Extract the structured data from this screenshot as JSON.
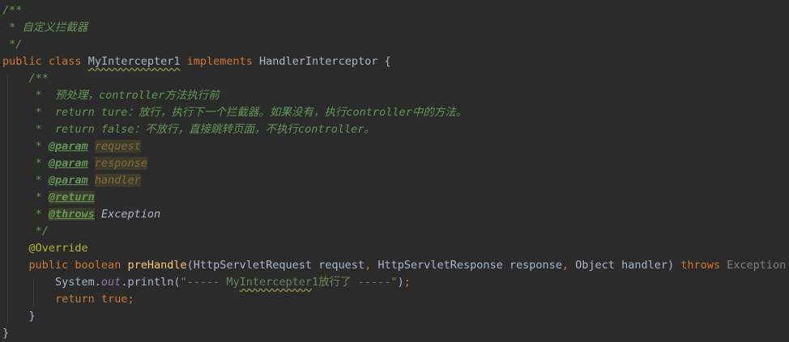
{
  "editor": {
    "lines": [
      {
        "segments": [
          {
            "t": "/**",
            "c": "cmt"
          }
        ]
      },
      {
        "segments": [
          {
            "t": " * 自定义拦截器",
            "c": "cmt"
          }
        ]
      },
      {
        "segments": [
          {
            "t": " */",
            "c": "cmt"
          }
        ]
      },
      {
        "segments": [
          {
            "t": "public ",
            "c": "kw"
          },
          {
            "t": "class ",
            "c": "kw"
          },
          {
            "t": "MyIntercepter1",
            "c": "squig"
          },
          {
            "t": " "
          },
          {
            "t": "implements ",
            "c": "kw"
          },
          {
            "t": "HandlerInterceptor {"
          }
        ]
      },
      {
        "segments": [
          {
            "t": "    /**",
            "c": "cmt"
          }
        ]
      },
      {
        "segments": [
          {
            "t": "     *  预处理，controller方法执行前",
            "c": "cmt"
          }
        ]
      },
      {
        "segments": [
          {
            "t": "     *  return ture：放行，执行下一个拦截器。如果没有，执行controller中的方法。",
            "c": "cmt"
          }
        ]
      },
      {
        "segments": [
          {
            "t": "     *  return false：不放行，直接跳转页面，不执行controller。",
            "c": "cmt"
          }
        ]
      },
      {
        "segments": [
          {
            "t": "     * ",
            "c": "cmt"
          },
          {
            "t": "@param",
            "c": "tag"
          },
          {
            "t": " ",
            "c": "cmt"
          },
          {
            "t": "request",
            "c": "pname"
          }
        ]
      },
      {
        "segments": [
          {
            "t": "     * ",
            "c": "cmt"
          },
          {
            "t": "@param",
            "c": "tag"
          },
          {
            "t": " ",
            "c": "cmt"
          },
          {
            "t": "response",
            "c": "pname"
          }
        ]
      },
      {
        "segments": [
          {
            "t": "     * ",
            "c": "cmt"
          },
          {
            "t": "@param",
            "c": "tag"
          },
          {
            "t": " ",
            "c": "cmt"
          },
          {
            "t": "handler",
            "c": "pname"
          }
        ]
      },
      {
        "segments": [
          {
            "t": "     * ",
            "c": "cmt"
          },
          {
            "t": "@return",
            "c": "tag tagbox"
          }
        ]
      },
      {
        "segments": [
          {
            "t": "     * ",
            "c": "cmt"
          },
          {
            "t": "@throws",
            "c": "tag tagbox"
          },
          {
            "t": " ",
            "c": "cmt"
          },
          {
            "t": "Exception",
            "c": "ex"
          }
        ]
      },
      {
        "segments": [
          {
            "t": "     */",
            "c": "cmt"
          }
        ]
      },
      {
        "segments": [
          {
            "t": "    "
          },
          {
            "t": "@Override",
            "c": "ann"
          }
        ]
      },
      {
        "segments": [
          {
            "t": "    "
          },
          {
            "t": "public ",
            "c": "kw"
          },
          {
            "t": "boolean ",
            "c": "kw"
          },
          {
            "t": "preHandle",
            "c": "fn"
          },
          {
            "t": "(HttpServletRequest request"
          },
          {
            "t": ", ",
            "c": "kw"
          },
          {
            "t": "HttpServletResponse response"
          },
          {
            "t": ", ",
            "c": "kw"
          },
          {
            "t": "Object handler) "
          },
          {
            "t": "throws ",
            "c": "kw"
          },
          {
            "t": "Exception",
            "c": "gray"
          },
          {
            "t": " {"
          }
        ]
      },
      {
        "segments": [
          {
            "t": "        System."
          },
          {
            "t": "out",
            "c": "fld"
          },
          {
            "t": ".println("
          },
          {
            "t": "\"----- My",
            "c": "str"
          },
          {
            "t": "Intercepter",
            "c": "str squig"
          },
          {
            "t": "1放行了 -----\"",
            "c": "str"
          },
          {
            "t": ")"
          },
          {
            "t": ";",
            "c": "kw"
          }
        ]
      },
      {
        "segments": [
          {
            "t": "        "
          },
          {
            "t": "return ",
            "c": "kw"
          },
          {
            "t": "true",
            "c": "kw"
          },
          {
            "t": ";",
            "c": "kw"
          }
        ]
      },
      {
        "segments": [
          {
            "t": "    }"
          }
        ]
      },
      {
        "segments": [
          {
            "t": "}"
          }
        ]
      }
    ]
  }
}
